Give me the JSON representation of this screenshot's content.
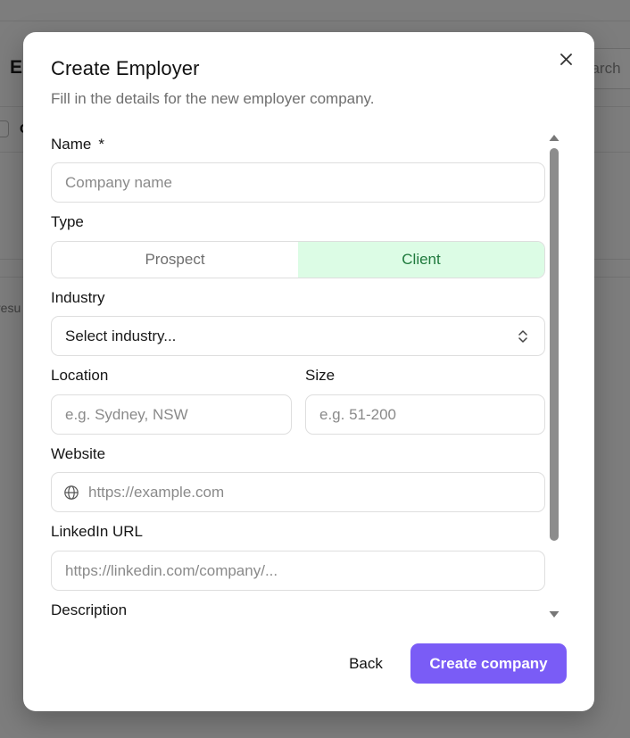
{
  "background": {
    "page_title_fragment": "E",
    "search_fragment": "earch",
    "column_fragment": "C",
    "results_fragment": "resu"
  },
  "dialog": {
    "title": "Create Employer",
    "subtitle": "Fill in the details for the new employer company.",
    "close_icon": "close-icon"
  },
  "form": {
    "name": {
      "label": "Name",
      "required_marker": "*",
      "placeholder": "Company name"
    },
    "type": {
      "label": "Type",
      "options": [
        "Prospect",
        "Client"
      ],
      "selected": "Client"
    },
    "industry": {
      "label": "Industry",
      "value": "Select industry...",
      "icon": "chevron-up-down-icon"
    },
    "location": {
      "label": "Location",
      "placeholder": "e.g. Sydney, NSW"
    },
    "size": {
      "label": "Size",
      "placeholder": "e.g. 51-200"
    },
    "website": {
      "label": "Website",
      "placeholder": "https://example.com",
      "icon": "globe-icon"
    },
    "linkedin": {
      "label": "LinkedIn URL",
      "placeholder": "https://linkedin.com/company/..."
    },
    "description": {
      "label": "Description"
    }
  },
  "footer": {
    "back_label": "Back",
    "create_label": "Create company"
  },
  "colors": {
    "accent": "#7a5cf6",
    "selected_toggle_bg": "#dcfce5",
    "selected_toggle_text": "#1f7a3d",
    "overlay": "rgba(0,0,0,0.5)"
  }
}
